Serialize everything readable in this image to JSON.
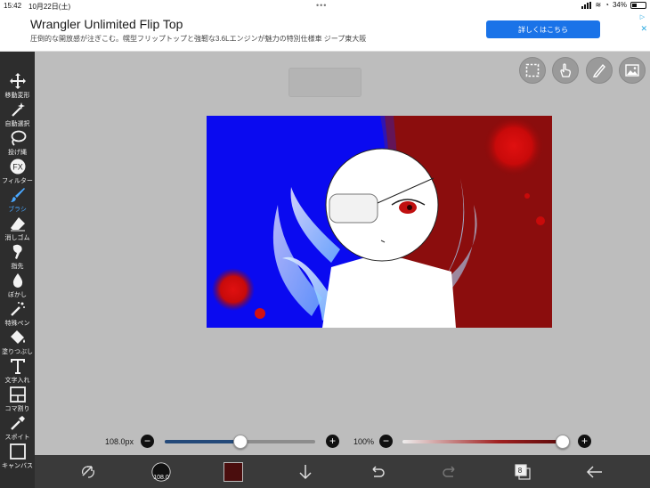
{
  "status_bar": {
    "time": "15:42",
    "date": "10月22日(土)",
    "battery": "34%"
  },
  "ad": {
    "title": "Wrangler Unlimited Flip Top",
    "description": "圧倒的な開放感が注ぎこむ。幌型フリップトップと強靭な3.6Lエンジンが魅力の特別仕様車 ジープ東大阪",
    "cta": "詳しくはこちら"
  },
  "toolbar": {
    "items": [
      {
        "label": "移動変形",
        "icon": "move-icon"
      },
      {
        "label": "自動選択",
        "icon": "magic-wand-icon"
      },
      {
        "label": "投げ縄",
        "icon": "lasso-icon"
      },
      {
        "label": "フィルター",
        "icon": "fx-icon"
      },
      {
        "label": "ブラシ",
        "icon": "brush-icon",
        "active": true
      },
      {
        "label": "消しゴム",
        "icon": "eraser-icon"
      },
      {
        "label": "指先",
        "icon": "finger-icon"
      },
      {
        "label": "ぼかし",
        "icon": "blur-drop-icon"
      },
      {
        "label": "特殊ペン",
        "icon": "special-pen-icon"
      },
      {
        "label": "塗りつぶし",
        "icon": "fill-bucket-icon"
      },
      {
        "label": "文字入れ",
        "icon": "text-icon"
      },
      {
        "label": "コマ割り",
        "icon": "frame-divider-icon"
      },
      {
        "label": "スポイト",
        "icon": "eyedropper-icon"
      },
      {
        "label": "キャンバス",
        "icon": "canvas-icon"
      }
    ]
  },
  "canvas_tools": [
    "selection-icon",
    "hand-gesture-icon",
    "ruler-pen-icon",
    "reference-image-icon"
  ],
  "brush": {
    "size_label": "108.0px",
    "size_fraction": 0.5,
    "opacity_label": "100%",
    "opacity_fraction": 1.0,
    "preview_label": "108.0"
  },
  "colors": {
    "current": "#4a0d0d",
    "accent": "#4aa8ff",
    "ad_button": "#1a73e8"
  },
  "bottom_bar": {
    "layer_count": "8"
  }
}
